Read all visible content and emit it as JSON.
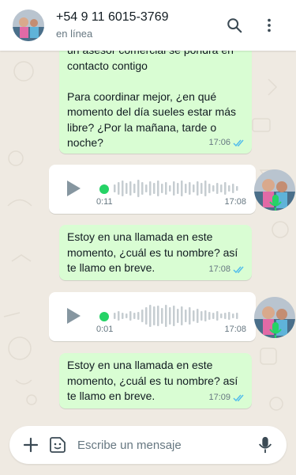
{
  "header": {
    "contact_name": "+54 9 11 6015-3769",
    "status": "en línea",
    "avatar_icon": "contact-avatar-photo",
    "search_icon": "search-icon",
    "menu_icon": "more-vertical-icon"
  },
  "messages": [
    {
      "type": "text",
      "direction": "outgoing",
      "text": "un asesor comercial se pondrá en contacto contigo\n\nPara coordinar mejor, ¿en qué momento del día sueles estar más libre? ¿Por la mañana, tarde o noche?",
      "time": "17:06",
      "status": "read"
    },
    {
      "type": "voice",
      "direction": "incoming",
      "duration": "0:11",
      "time": "17:08"
    },
    {
      "type": "text",
      "direction": "outgoing",
      "text": "Estoy en una llamada en este momento, ¿cuál es tu nombre? así te llamo en breve.",
      "time": "17:08",
      "status": "read"
    },
    {
      "type": "voice",
      "direction": "incoming",
      "duration": "0:01",
      "time": "17:08"
    },
    {
      "type": "text",
      "direction": "outgoing",
      "text": "Estoy en una llamada en este momento, ¿cuál es tu nombre? así te llamo en breve.",
      "time": "17:09",
      "status": "read"
    }
  ],
  "composer": {
    "placeholder": "Escribe un mensaje",
    "attach_icon": "plus-icon",
    "sticker_icon": "sticker-icon",
    "mic_icon": "microphone-icon"
  },
  "colors": {
    "outgoing_bubble": "#d9fdd3",
    "incoming_bubble": "#ffffff",
    "read_ticks": "#53bdeb",
    "accent_green": "#25d366",
    "chat_background": "#efeae2"
  }
}
